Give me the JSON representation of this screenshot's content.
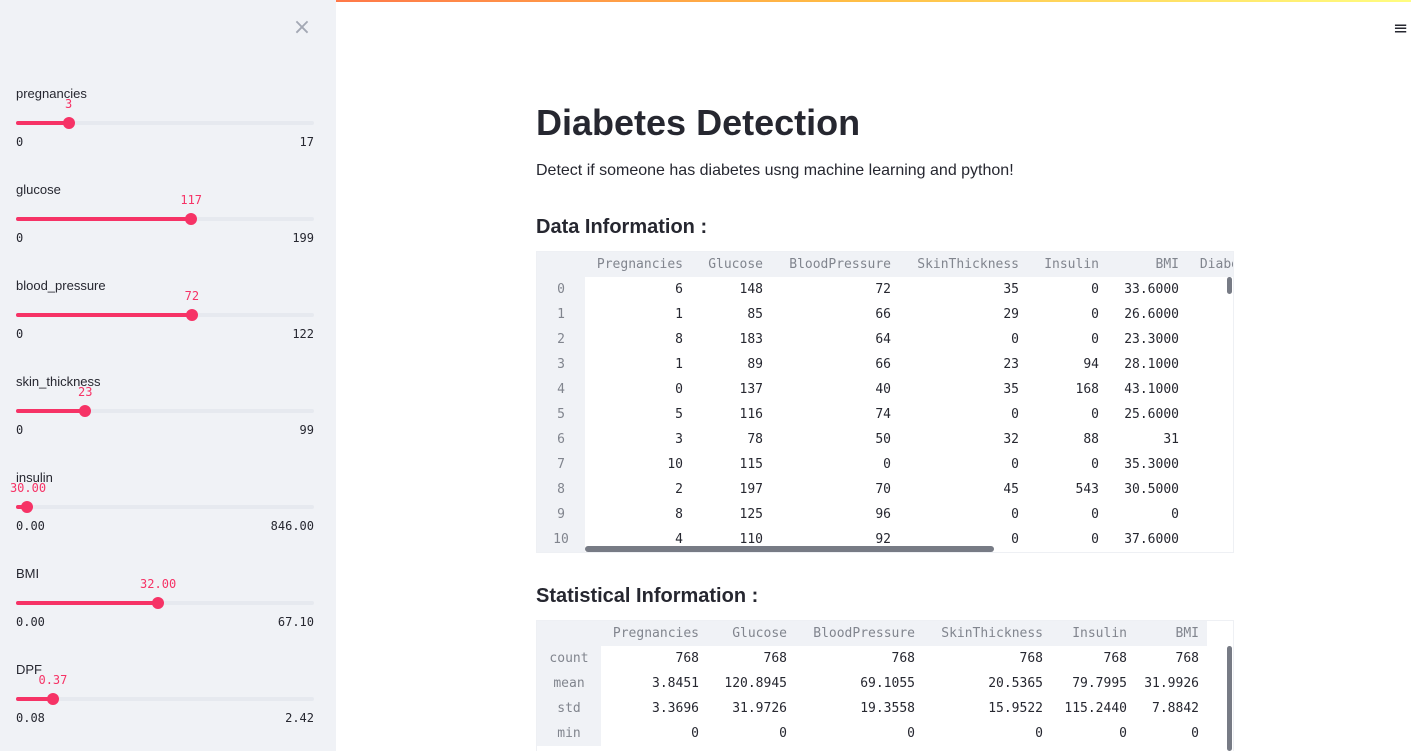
{
  "sidebar": {
    "close_icon": "close-icon",
    "sliders": [
      {
        "label": "pregnancies",
        "value": "3",
        "min": "0",
        "max": "17",
        "fraction": 0.1765
      },
      {
        "label": "glucose",
        "value": "117",
        "min": "0",
        "max": "199",
        "fraction": 0.5879
      },
      {
        "label": "blood_pressure",
        "value": "72",
        "min": "0",
        "max": "122",
        "fraction": 0.5902
      },
      {
        "label": "skin_thickness",
        "value": "23",
        "min": "0",
        "max": "99",
        "fraction": 0.2323
      },
      {
        "label": "insulin",
        "value": "30.00",
        "min": "0.00",
        "max": "846.00",
        "fraction": 0.0355
      },
      {
        "label": "BMI",
        "value": "32.00",
        "min": "0.00",
        "max": "67.10",
        "fraction": 0.4769
      },
      {
        "label": "DPF",
        "value": "0.37",
        "min": "0.08",
        "max": "2.42",
        "fraction": 0.1239
      }
    ]
  },
  "header": {
    "menu_icon": "hamburger-menu-icon"
  },
  "main": {
    "title": "Diabetes Detection",
    "subtitle": "Detect if someone has diabetes usng machine learning and python!",
    "data_heading": "Data Information :",
    "stats_heading": "Statistical Information :"
  },
  "data_table": {
    "columns": [
      "Pregnancies",
      "Glucose",
      "BloodPressure",
      "SkinThickness",
      "Insulin",
      "BMI",
      "Diabe"
    ],
    "index": [
      "0",
      "1",
      "2",
      "3",
      "4",
      "5",
      "6",
      "7",
      "8",
      "9",
      "10"
    ],
    "rows": [
      [
        "6",
        "148",
        "72",
        "35",
        "0",
        "33.6000",
        ""
      ],
      [
        "1",
        "85",
        "66",
        "29",
        "0",
        "26.6000",
        ""
      ],
      [
        "8",
        "183",
        "64",
        "0",
        "0",
        "23.3000",
        ""
      ],
      [
        "1",
        "89",
        "66",
        "23",
        "94",
        "28.1000",
        ""
      ],
      [
        "0",
        "137",
        "40",
        "35",
        "168",
        "43.1000",
        ""
      ],
      [
        "5",
        "116",
        "74",
        "0",
        "0",
        "25.6000",
        ""
      ],
      [
        "3",
        "78",
        "50",
        "32",
        "88",
        "31",
        ""
      ],
      [
        "10",
        "115",
        "0",
        "0",
        "0",
        "35.3000",
        ""
      ],
      [
        "2",
        "197",
        "70",
        "45",
        "543",
        "30.5000",
        ""
      ],
      [
        "8",
        "125",
        "96",
        "0",
        "0",
        "0",
        ""
      ],
      [
        "4",
        "110",
        "92",
        "0",
        "0",
        "37.6000",
        ""
      ]
    ]
  },
  "stats_table": {
    "columns": [
      "Pregnancies",
      "Glucose",
      "BloodPressure",
      "SkinThickness",
      "Insulin",
      "BMI"
    ],
    "index": [
      "count",
      "mean",
      "std",
      "min"
    ],
    "rows": [
      [
        "768",
        "768",
        "768",
        "768",
        "768",
        "768"
      ],
      [
        "3.8451",
        "120.8945",
        "69.1055",
        "20.5365",
        "79.7995",
        "31.9926"
      ],
      [
        "3.3696",
        "31.9726",
        "19.3558",
        "15.9522",
        "115.2440",
        "7.8842"
      ],
      [
        "0",
        "0",
        "0",
        "0",
        "0",
        "0"
      ]
    ]
  },
  "colors": {
    "accent": "#f63366",
    "sidebar_bg": "#f0f2f6",
    "text": "#262730"
  }
}
